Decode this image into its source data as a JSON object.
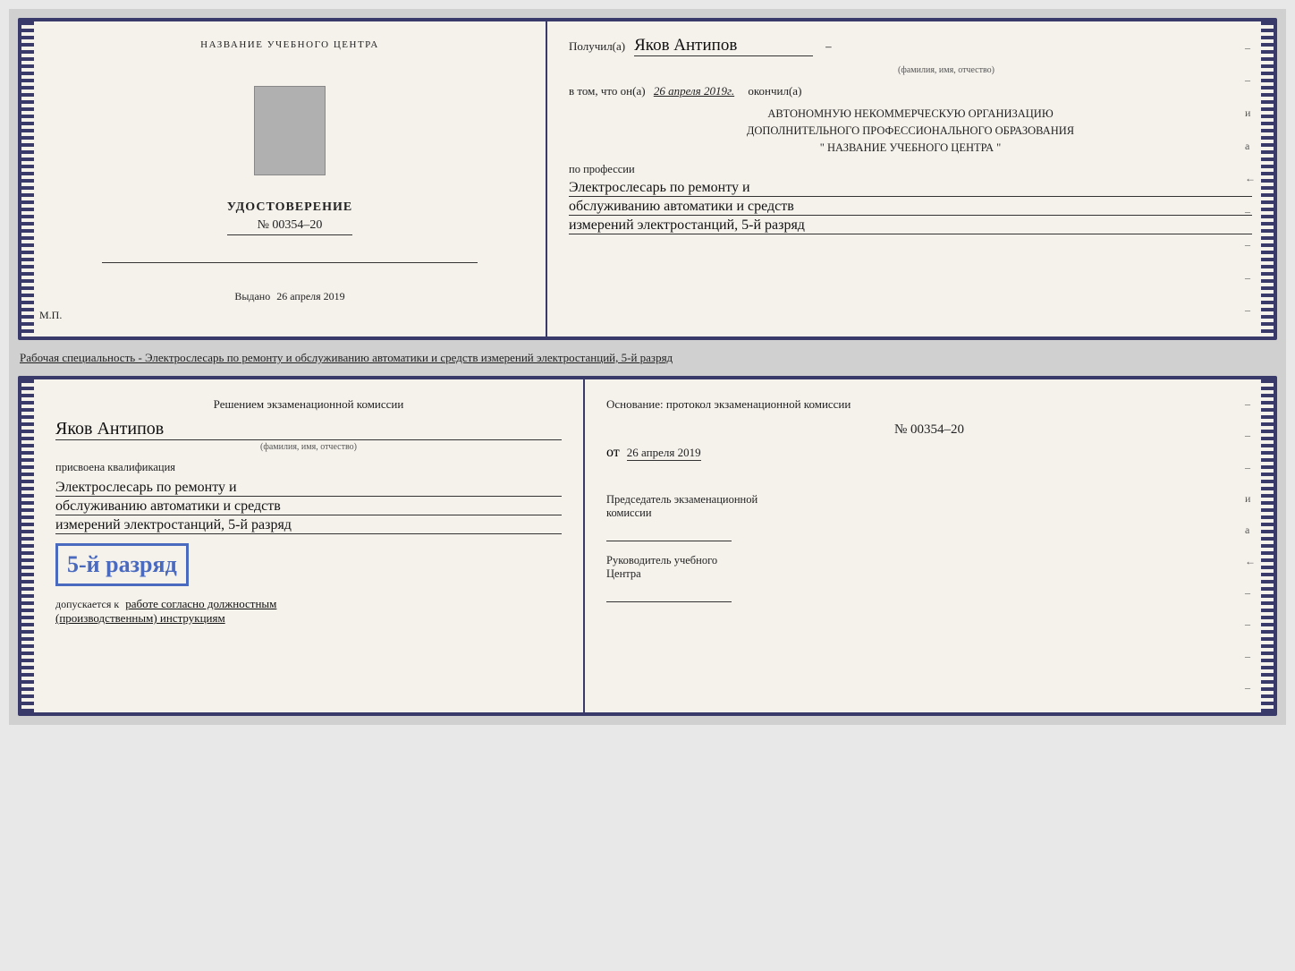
{
  "page": {
    "background_color": "#d0d0d0"
  },
  "top_doc": {
    "left": {
      "org_name": "НАЗВАНИЕ УЧЕБНОГО ЦЕНТРА",
      "cert_title": "УДОСТОВЕРЕНИЕ",
      "cert_number": "№ 00354–20",
      "issued_label": "Выдано",
      "issued_date": "26 апреля 2019",
      "mp_label": "М.П."
    },
    "right": {
      "received_label": "Получил(а)",
      "received_name": "Яков Антипов",
      "fio_label": "(фамилия, имя, отчество)",
      "dash": "–",
      "in_that_label": "в том, что он(а)",
      "completed_date": "26 апреля 2019г.",
      "completed_label": "окончил(а)",
      "org_block_line1": "АВТОНОМНУЮ НЕКОММЕРЧЕСКУЮ ОРГАНИЗАЦИЮ",
      "org_block_line2": "ДОПОЛНИТЕЛЬНОГО ПРОФЕССИОНАЛЬНОГО ОБРАЗОВАНИЯ",
      "org_block_line3": "\" НАЗВАНИЕ УЧЕБНОГО ЦЕНТРА \"",
      "profession_label": "по профессии",
      "profession_line1": "Электрослесарь по ремонту и",
      "profession_line2": "обслуживанию автоматики и средств",
      "profession_line3": "измерений электростанций, 5-й разряд"
    }
  },
  "description_text": "Рабочая специальность - Электрослесарь по ремонту и обслуживанию автоматики и средств измерений электростанций, 5-й разряд",
  "bottom_doc": {
    "left": {
      "commission_title": "Решением экзаменационной комиссии",
      "person_name": "Яков Антипов",
      "fio_label": "(фамилия, имя, отчество)",
      "qualification_label": "присвоена квалификация",
      "qual_line1": "Электрослесарь по ремонту и",
      "qual_line2": "обслуживанию автоматики и средств",
      "qual_line3": "измерений электростанций, 5-й разряд",
      "rank_stamp": "5-й разряд",
      "allowed_label": "допускается к",
      "allowed_text": "работе согласно должностным",
      "allowed_text2": "(производственным) инструкциям"
    },
    "right": {
      "basis_label": "Основание: протокол экзаменационной комиссии",
      "protocol_number": "№ 00354–20",
      "date_prefix": "от",
      "protocol_date": "26 апреля 2019",
      "chairman_label": "Председатель экзаменационной",
      "chairman_label2": "комиссии",
      "head_label": "Руководитель учебного",
      "head_label2": "Центра"
    }
  }
}
